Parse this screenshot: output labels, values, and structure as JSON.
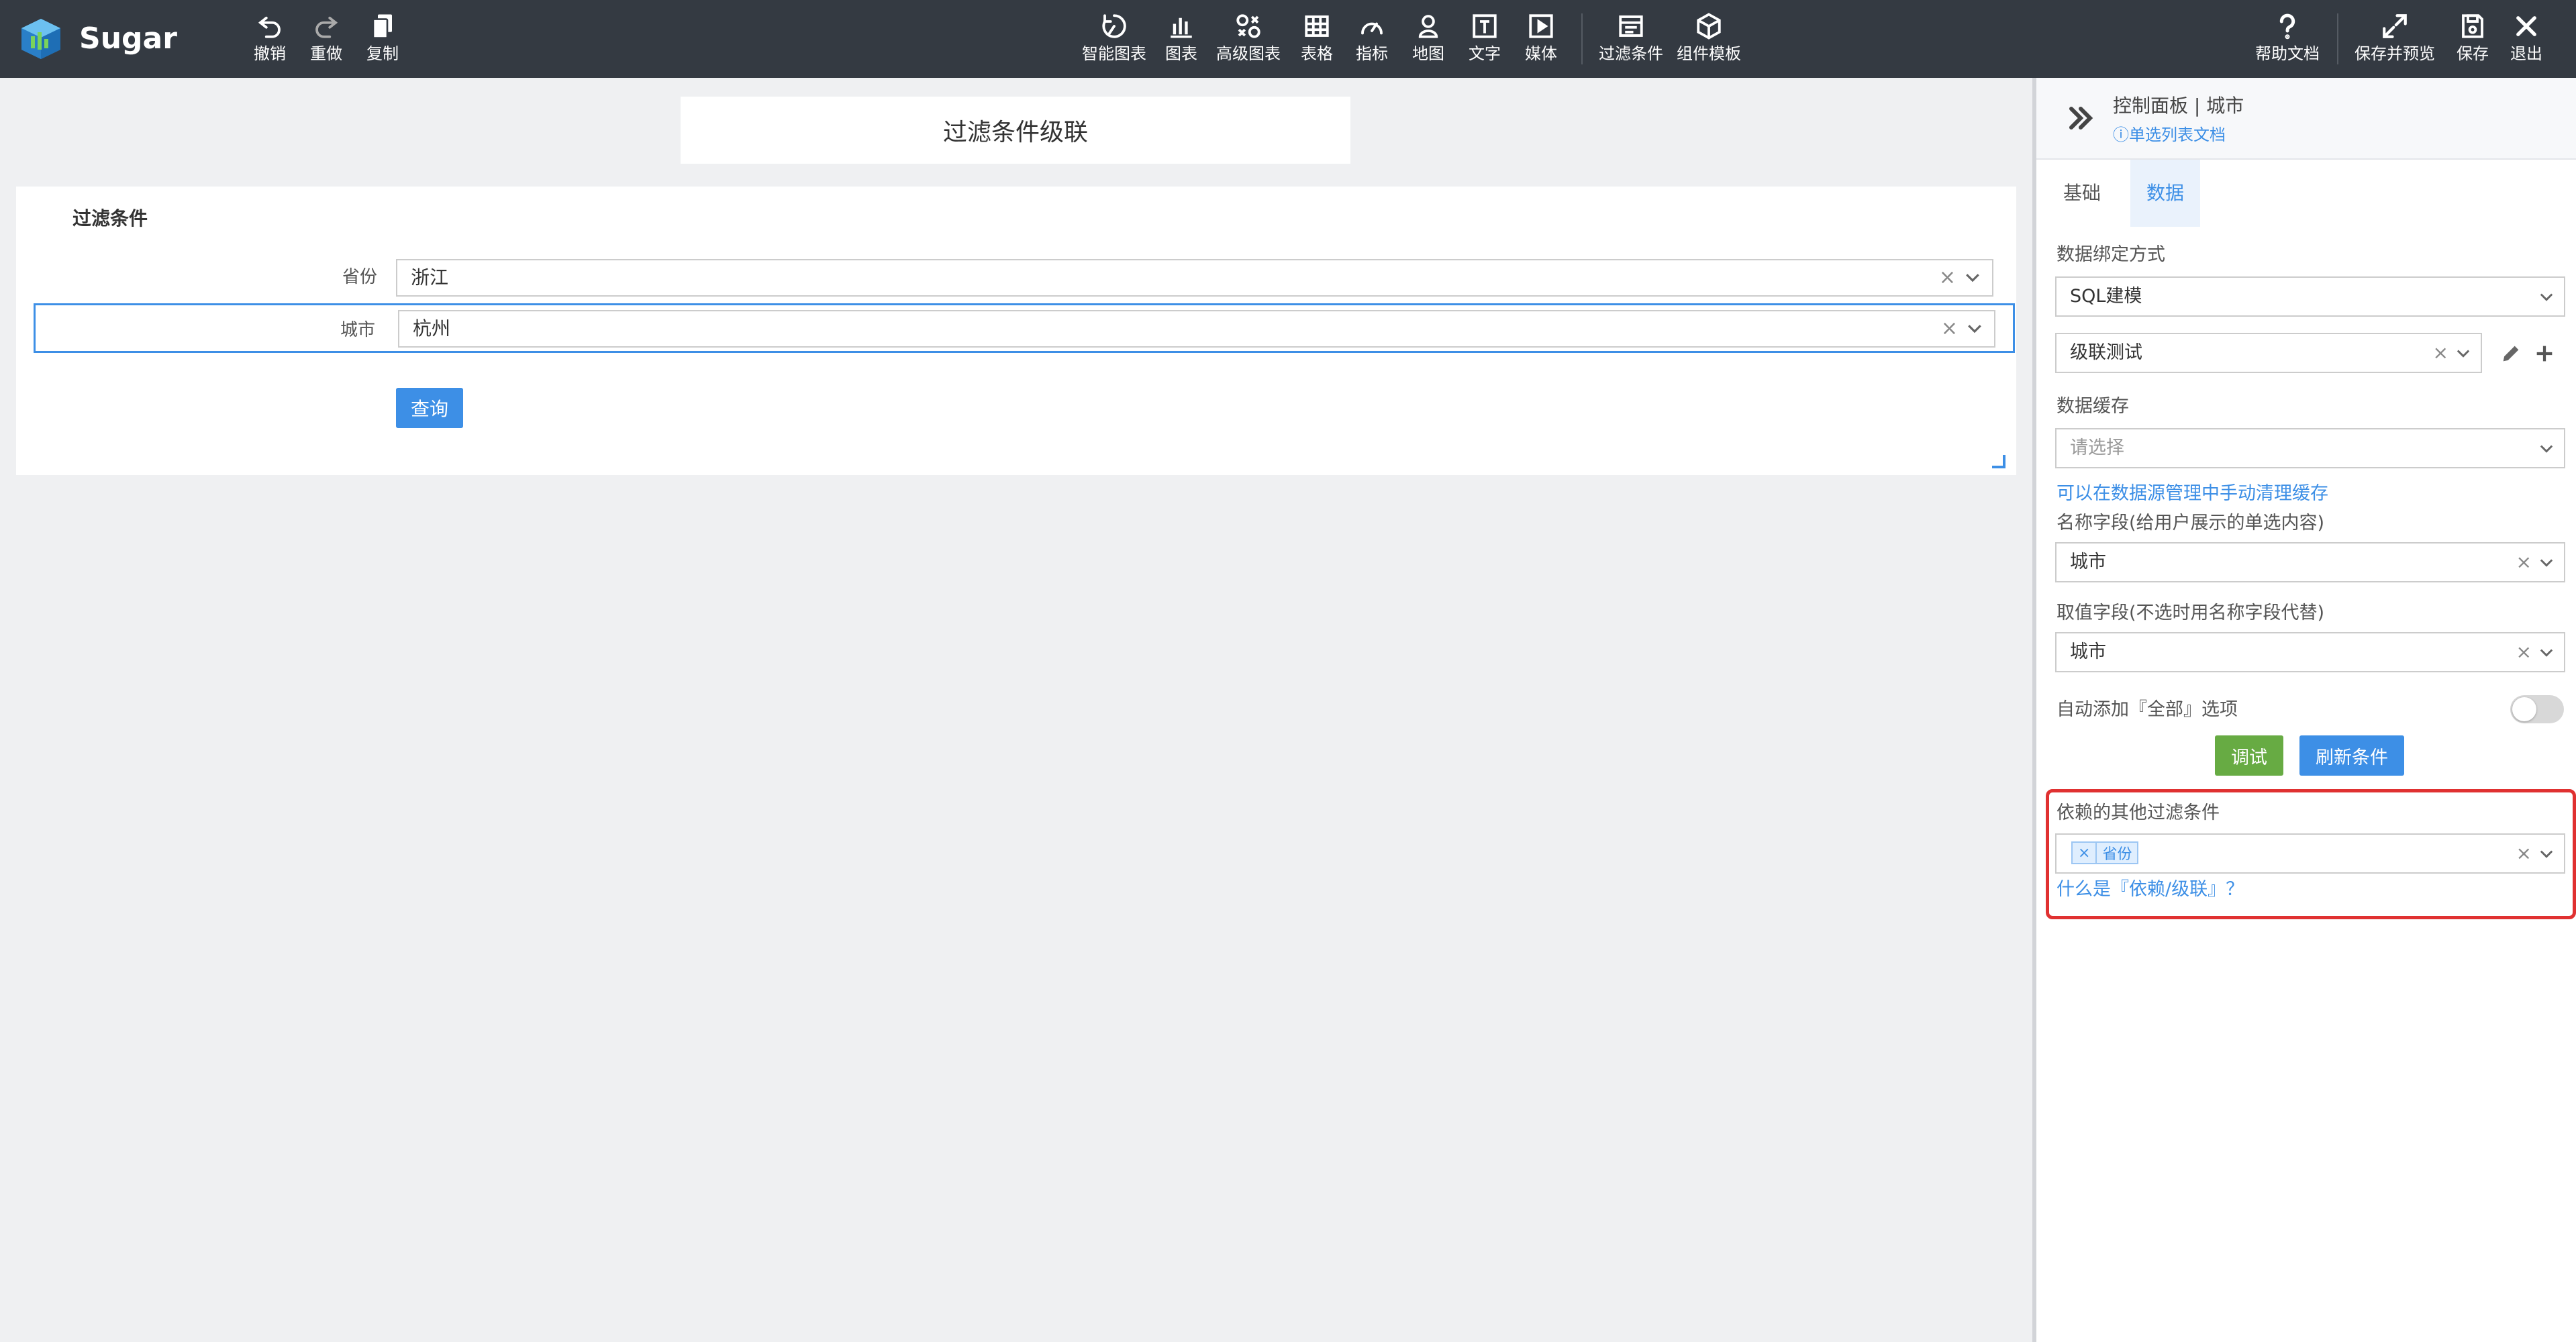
{
  "app": {
    "brand": "Sugar"
  },
  "toolbar": {
    "left": [
      {
        "id": "undo",
        "label": "撤销",
        "icon": "undo-icon"
      },
      {
        "id": "redo",
        "label": "重做",
        "icon": "redo-icon"
      },
      {
        "id": "copy",
        "label": "复制",
        "icon": "copy-icon"
      }
    ],
    "center": [
      {
        "id": "smart-chart",
        "label": "智能图表",
        "icon": "smart-chart-icon"
      },
      {
        "id": "chart",
        "label": "图表",
        "icon": "bar-chart-icon"
      },
      {
        "id": "adv-chart",
        "label": "高级图表",
        "icon": "advanced-chart-icon"
      },
      {
        "id": "table",
        "label": "表格",
        "icon": "table-icon"
      },
      {
        "id": "metric",
        "label": "指标",
        "icon": "gauge-icon"
      },
      {
        "id": "map",
        "label": "地图",
        "icon": "map-pin-icon"
      },
      {
        "id": "text",
        "label": "文字",
        "icon": "text-icon"
      },
      {
        "id": "media",
        "label": "媒体",
        "icon": "media-icon"
      },
      {
        "id": "filter",
        "label": "过滤条件",
        "icon": "filter-icon"
      },
      {
        "id": "template",
        "label": "组件模板",
        "icon": "component-template-icon"
      }
    ],
    "right": [
      {
        "id": "help",
        "label": "帮助文档",
        "icon": "help-icon"
      },
      {
        "id": "save-preview",
        "label": "保存并预览",
        "icon": "expand-icon"
      },
      {
        "id": "save",
        "label": "保存",
        "icon": "save-icon"
      },
      {
        "id": "exit",
        "label": "退出",
        "icon": "close-icon"
      }
    ]
  },
  "canvas": {
    "title": "过滤条件级联",
    "filter_card": {
      "heading": "过滤条件",
      "rows": [
        {
          "label": "省份",
          "value": "浙江",
          "selected": false
        },
        {
          "label": "城市",
          "value": "杭州",
          "selected": true
        }
      ],
      "query_label": "查询"
    }
  },
  "panel": {
    "title": "控制面板 | 城市",
    "doc_link": "单选列表文档",
    "tabs": [
      {
        "label": "基础",
        "active": false
      },
      {
        "label": "数据",
        "active": true
      }
    ],
    "binding_label": "数据绑定方式",
    "binding_value": "SQL建模",
    "model_value": "级联测试",
    "cache_label": "数据缓存",
    "cache_placeholder": "请选择",
    "cache_link": "可以在数据源管理中手动清理缓存",
    "name_field_label": "名称字段(给用户展示的单选内容)",
    "name_field_value": "城市",
    "value_field_label": "取值字段(不选时用名称字段代替)",
    "value_field_value": "城市",
    "auto_all_label": "自动添加『全部』选项",
    "auto_all_on": false,
    "debug_label": "调试",
    "refresh_label": "刷新条件",
    "depends_label": "依赖的其他过滤条件",
    "depends_tags": [
      "省份"
    ],
    "depends_help": "什么是『依赖/级联』？"
  },
  "colors": {
    "topbar": "#343a42",
    "accent": "#3d8fe6",
    "success": "#67ab43",
    "highlight": "#e03131"
  }
}
